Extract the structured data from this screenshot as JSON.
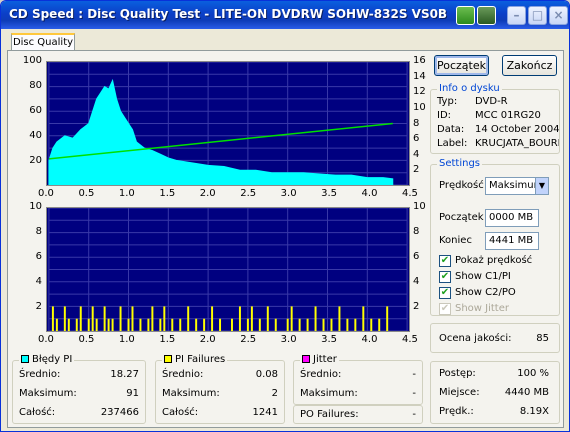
{
  "window": {
    "title": "CD Speed : Disc Quality Test - LITE-ON DVDRW SOHW-832S  VS0B"
  },
  "tabs": [
    "Disc Quality"
  ],
  "buttons": {
    "start": "Początek",
    "finish": "Zakończ"
  },
  "charts": {
    "top": {
      "y_left_ticks": [
        "100",
        "80",
        "60",
        "40",
        "20"
      ],
      "y_right_ticks": [
        "16",
        "14",
        "12",
        "10",
        "8",
        "6",
        "4",
        "2"
      ],
      "x_ticks": [
        "0.0",
        "0.5",
        "1.0",
        "1.5",
        "2.0",
        "2.5",
        "3.0",
        "3.5",
        "4.0",
        "4.5"
      ]
    },
    "bottom": {
      "y_left_ticks": [
        "10",
        "8",
        "6",
        "4",
        "2"
      ],
      "y_right_ticks": [
        "10",
        "8",
        "6",
        "4",
        "2"
      ],
      "x_ticks": [
        "0.0",
        "0.5",
        "1.0",
        "1.5",
        "2.0",
        "2.5",
        "3.0",
        "3.5",
        "4.0",
        "4.5"
      ]
    }
  },
  "chart_data": [
    {
      "type": "area",
      "xlabel": "",
      "ylabel": "",
      "xlim": [
        0,
        4.5
      ],
      "ylim": [
        0,
        100
      ],
      "y2lim": [
        0,
        16
      ],
      "series": [
        {
          "color": "#00ffff",
          "x": [
            0.0,
            0.05,
            0.1,
            0.2,
            0.3,
            0.4,
            0.5,
            0.55,
            0.6,
            0.65,
            0.7,
            0.75,
            0.8,
            0.85,
            0.9,
            0.95,
            1.0,
            1.05,
            1.1,
            1.2,
            1.3,
            1.4,
            1.5,
            1.6,
            1.8,
            2.0,
            2.2,
            2.4,
            2.6,
            2.8,
            3.0,
            3.2,
            3.4,
            3.6,
            3.8,
            4.0,
            4.2,
            4.32
          ],
          "y": [
            20,
            30,
            35,
            40,
            38,
            45,
            50,
            60,
            70,
            75,
            80,
            78,
            85,
            70,
            60,
            55,
            50,
            45,
            35,
            30,
            28,
            25,
            22,
            20,
            18,
            16,
            15,
            12,
            12,
            10,
            10,
            10,
            9,
            8,
            8,
            6,
            6,
            5
          ]
        },
        {
          "color": "#00e000",
          "axis": "right",
          "x": [
            0.0,
            4.32
          ],
          "y": [
            3.4,
            8.0
          ]
        }
      ],
      "grid": true
    },
    {
      "type": "bar",
      "xlim": [
        0,
        4.5
      ],
      "ylim": [
        0,
        10
      ],
      "series": [
        {
          "color": "#ffff00",
          "x": [
            0.05,
            0.1,
            0.2,
            0.25,
            0.35,
            0.4,
            0.5,
            0.55,
            0.6,
            0.7,
            0.75,
            0.8,
            0.9,
            1.0,
            1.05,
            1.15,
            1.25,
            1.3,
            1.4,
            1.45,
            1.55,
            1.65,
            1.75,
            1.85,
            1.95,
            2.05,
            2.15,
            2.3,
            2.4,
            2.5,
            2.55,
            2.65,
            2.75,
            2.85,
            3.0,
            3.05,
            3.15,
            3.25,
            3.35,
            3.45,
            3.55,
            3.65,
            3.75,
            3.85,
            3.95,
            4.05,
            4.15,
            4.25
          ],
          "y": [
            2,
            1,
            2,
            1,
            1,
            2,
            1,
            2,
            1,
            2,
            1,
            1,
            2,
            1,
            2,
            1,
            1,
            2,
            1,
            2,
            1,
            1,
            2,
            1,
            1,
            2,
            1,
            1,
            2,
            1,
            2,
            1,
            2,
            1,
            1,
            2,
            1,
            1,
            2,
            1,
            1,
            2,
            1,
            1,
            2,
            1,
            1,
            2
          ]
        }
      ],
      "grid": true
    }
  ],
  "disc_info": {
    "title": "Info o dysku",
    "rows": [
      {
        "label": "Typ:",
        "value": "DVD-R"
      },
      {
        "label": "ID:",
        "value": "MCC 01RG20"
      },
      {
        "label": "Data:",
        "value": "14 October 2004"
      },
      {
        "label": "Label:",
        "value": "KRUCJATA_BOURNE"
      }
    ]
  },
  "settings": {
    "title": "Settings",
    "speed_label": "Prędkość",
    "speed_value": "Maksimum",
    "start_label": "Początek",
    "start_value": "0000 MB",
    "end_label": "Koniec",
    "end_value": "4441 MB",
    "checkboxes": [
      {
        "label": "Pokaż prędkość",
        "checked": true,
        "enabled": true
      },
      {
        "label": "Show C1/PI",
        "checked": true,
        "enabled": true
      },
      {
        "label": "Show C2/PO",
        "checked": true,
        "enabled": true
      },
      {
        "label": "Show Jitter",
        "checked": true,
        "enabled": false
      }
    ]
  },
  "quality": {
    "label": "Ocena jakości:",
    "value": "85"
  },
  "pi_errors": {
    "title": "Błędy PI",
    "color": "#00ffff",
    "rows": [
      {
        "label": "Średnio:",
        "value": "18.27"
      },
      {
        "label": "Maksimum:",
        "value": "91"
      },
      {
        "label": "Całość:",
        "value": "237466"
      }
    ]
  },
  "pi_failures": {
    "title": "PI Failures",
    "color": "#ffff00",
    "rows": [
      {
        "label": "Średnio:",
        "value": "0.08"
      },
      {
        "label": "Maksimum:",
        "value": "2"
      },
      {
        "label": "Całość:",
        "value": "1241"
      }
    ]
  },
  "jitter": {
    "title": "Jitter",
    "color": "#ff00ff",
    "rows": [
      {
        "label": "Średnio:",
        "value": "-"
      },
      {
        "label": "Maksimum:",
        "value": "-"
      }
    ],
    "po_label": "PO Failures:",
    "po_value": "-"
  },
  "progress": {
    "rows": [
      {
        "label": "Postęp:",
        "value": "100 %"
      },
      {
        "label": "Miejsce:",
        "value": "4440 MB"
      },
      {
        "label": "Prędk.:",
        "value": "8.19X"
      }
    ]
  }
}
